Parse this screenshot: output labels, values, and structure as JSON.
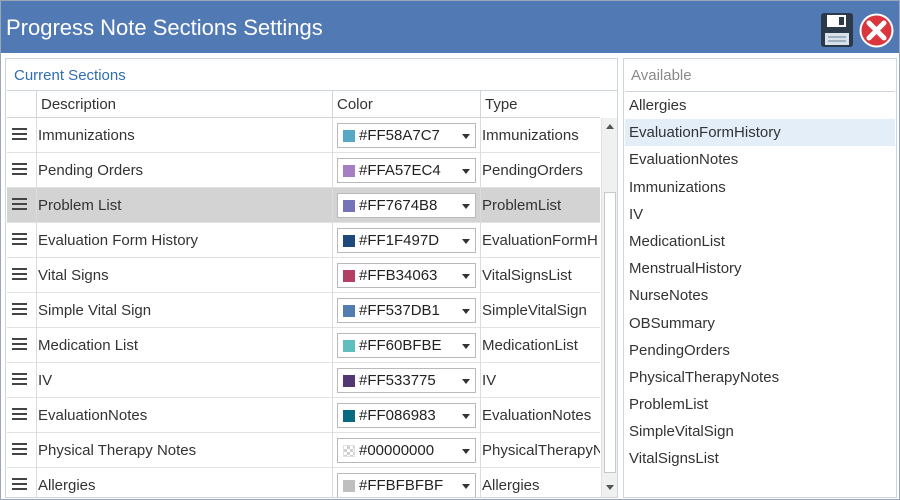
{
  "window": {
    "title": "Progress Note Sections Settings"
  },
  "current": {
    "header": "Current Sections",
    "columns": {
      "description": "Description",
      "color": "Color",
      "type": "Type"
    },
    "rows": [
      {
        "description": "Immunizations",
        "color": "#FF58A7C7",
        "swatch": "#58A7C7",
        "type": "Immunizations"
      },
      {
        "description": "Pending Orders",
        "color": "#FFA57EC4",
        "swatch": "#A57EC4",
        "type": "PendingOrders"
      },
      {
        "description": "Problem List",
        "color": "#FF7674B8",
        "swatch": "#7674B8",
        "type": "ProblemList",
        "selected": true
      },
      {
        "description": "Evaluation Form History",
        "color": "#FF1F497D",
        "swatch": "#1F497D",
        "type": "EvaluationFormH"
      },
      {
        "description": "Vital Signs",
        "color": "#FFB34063",
        "swatch": "#B34063",
        "type": "VitalSignsList"
      },
      {
        "description": "Simple Vital Sign",
        "color": "#FF537DB1",
        "swatch": "#537DB1",
        "type": "SimpleVitalSign"
      },
      {
        "description": "Medication List",
        "color": "#FF60BFBE",
        "swatch": "#60BFBE",
        "type": "MedicationList"
      },
      {
        "description": "IV",
        "color": "#FF533775",
        "swatch": "#533775",
        "type": "IV"
      },
      {
        "description": "EvaluationNotes",
        "color": "#FF086983",
        "swatch": "#086983",
        "type": "EvaluationNotes"
      },
      {
        "description": "Physical Therapy Notes",
        "color": "#00000000",
        "swatch": "transparent",
        "type": "PhysicalTherapyN"
      },
      {
        "description": "Allergies",
        "color": "#FFBFBFBF",
        "swatch": "#BFBFBF",
        "type": "Allergies"
      }
    ]
  },
  "available": {
    "header": "Available",
    "items": [
      {
        "label": "Allergies"
      },
      {
        "label": "EvaluationFormHistory",
        "highlighted": true
      },
      {
        "label": "EvaluationNotes"
      },
      {
        "label": "Immunizations"
      },
      {
        "label": "IV"
      },
      {
        "label": "MedicationList"
      },
      {
        "label": "MenstrualHistory"
      },
      {
        "label": "NurseNotes"
      },
      {
        "label": "OBSummary"
      },
      {
        "label": "PendingOrders"
      },
      {
        "label": "PhysicalTherapyNotes"
      },
      {
        "label": "ProblemList"
      },
      {
        "label": "SimpleVitalSign"
      },
      {
        "label": "VitalSignsList"
      }
    ]
  },
  "icons": {
    "save": "floppy-disk-icon",
    "close": "red-x-circle-icon"
  },
  "colors": {
    "titlebar": "#5179B4",
    "accent": "#2F6DB5",
    "selected_row": "#D3D3D3",
    "hover_item": "#E4EEF9",
    "close_red": "#D9363E"
  }
}
